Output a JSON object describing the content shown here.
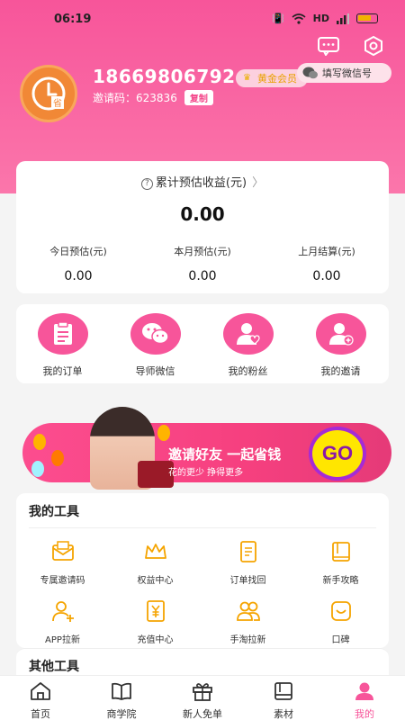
{
  "status_bar": {
    "time": "06:19",
    "network": "HD"
  },
  "profile": {
    "phone": "18669806792",
    "level": "黄金会员",
    "invite_label": "邀请码：",
    "invite_code": "623836",
    "copy_label": "复制",
    "wechat_button": "填写微信号"
  },
  "earnings": {
    "title": "累计预估收益(元)",
    "total": "0.00",
    "stats": [
      {
        "label": "今日预估(元)",
        "value": "0.00"
      },
      {
        "label": "本月预估(元)",
        "value": "0.00"
      },
      {
        "label": "上月结算(元)",
        "value": "0.00"
      }
    ]
  },
  "quick_actions": [
    {
      "label": "我的订单",
      "icon": "order-icon"
    },
    {
      "label": "导师微信",
      "icon": "wechat-icon"
    },
    {
      "label": "我的粉丝",
      "icon": "fans-icon"
    },
    {
      "label": "我的邀请",
      "icon": "invite-icon"
    }
  ],
  "banner": {
    "title": "邀请好友  一起省钱",
    "subtitle": "花的更少  挣得更多",
    "cta": "GO"
  },
  "tools": {
    "title": "我的工具",
    "items": [
      {
        "label": "专属邀请码",
        "icon": "envelope-icon"
      },
      {
        "label": "权益中心",
        "icon": "crown-icon"
      },
      {
        "label": "订单找回",
        "icon": "document-icon"
      },
      {
        "label": "新手攻略",
        "icon": "book-icon"
      },
      {
        "label": "APP拉新",
        "icon": "user-add-icon"
      },
      {
        "label": "充值中心",
        "icon": "yen-icon"
      },
      {
        "label": "手淘拉新",
        "icon": "users-icon"
      },
      {
        "label": "口碑",
        "icon": "smile-icon"
      }
    ]
  },
  "other_tools": {
    "title": "其他工具"
  },
  "tabbar": [
    {
      "label": "首页",
      "icon": "home-icon"
    },
    {
      "label": "商学院",
      "icon": "book-open-icon"
    },
    {
      "label": "新人免单",
      "icon": "gift-icon"
    },
    {
      "label": "素材",
      "icon": "material-icon"
    },
    {
      "label": "我的",
      "icon": "profile-icon",
      "active": true
    }
  ],
  "colors": {
    "brand": "#f7559a",
    "accent_gold": "#e8a200",
    "cta_yellow": "#ffe600"
  }
}
